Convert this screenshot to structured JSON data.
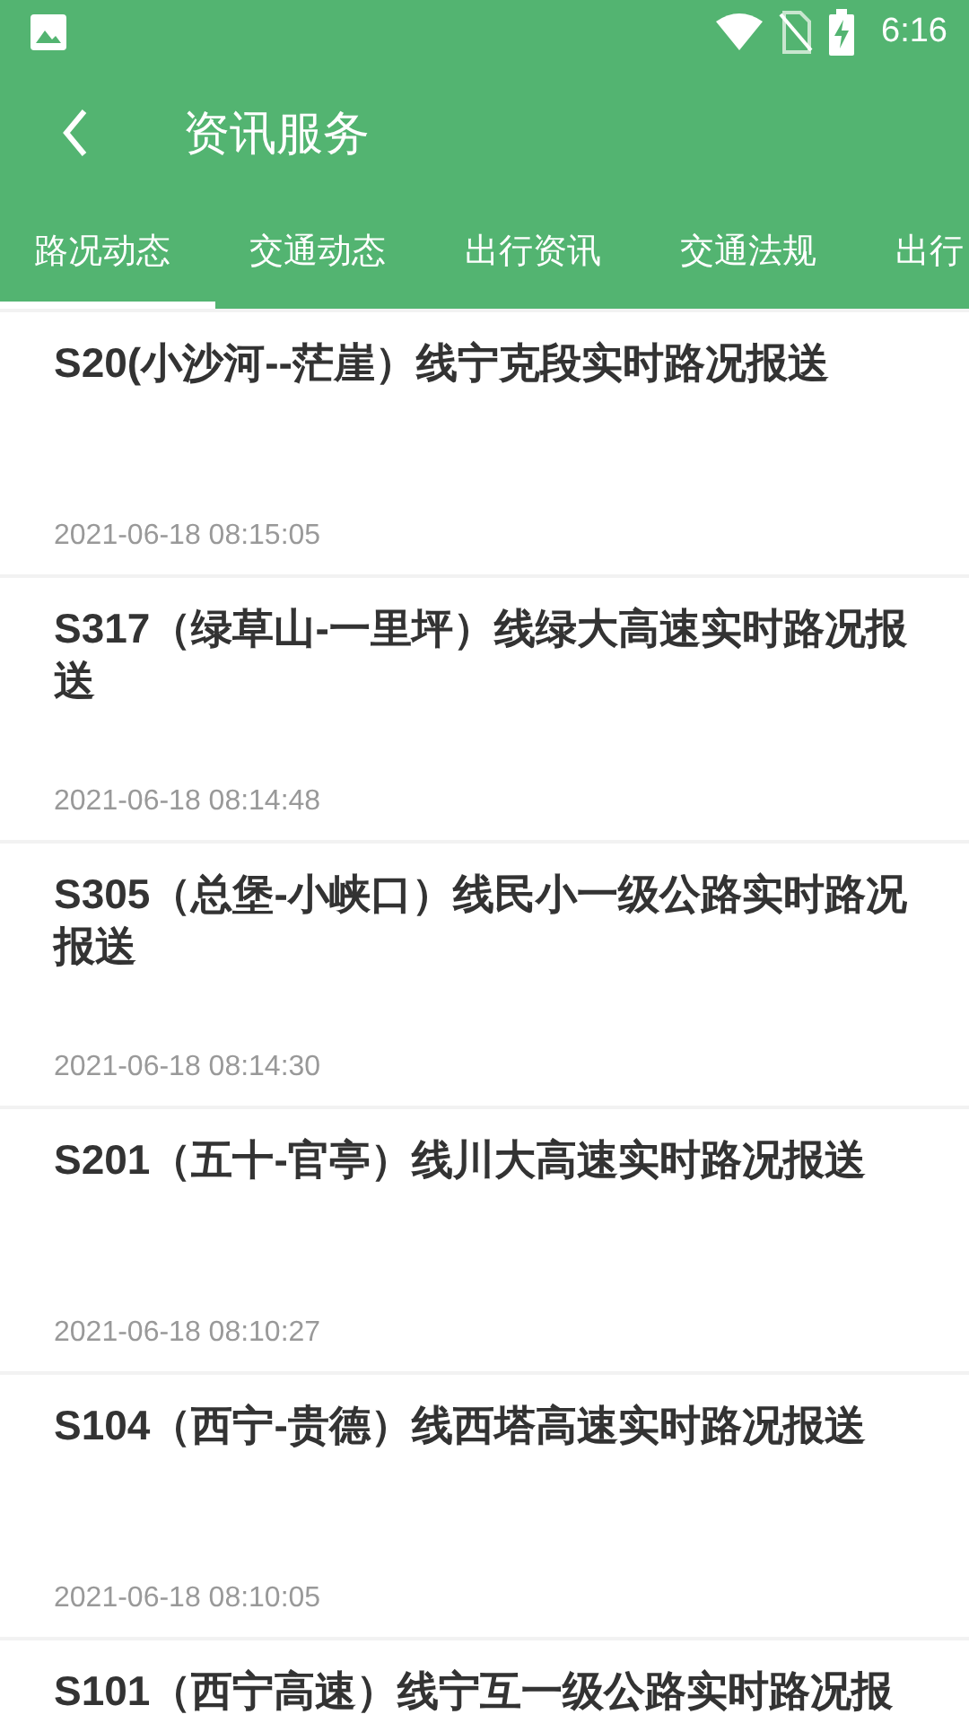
{
  "status_bar": {
    "time": "6:16"
  },
  "app_bar": {
    "title": "资讯服务"
  },
  "tabs": [
    {
      "label": "路况动态",
      "selected": true
    },
    {
      "label": "交通动态",
      "selected": false
    },
    {
      "label": "出行资讯",
      "selected": false
    },
    {
      "label": "交通法规",
      "selected": false
    },
    {
      "label": "出行",
      "selected": false
    }
  ],
  "news": [
    {
      "title": "S20(小沙河--茫崖）线宁克段实时路况报送",
      "date": "2021-06-18 08:15:05"
    },
    {
      "title": "S317（绿草山-一里坪）线绿大高速实时路况报送",
      "date": "2021-06-18 08:14:48"
    },
    {
      "title": "S305（总堡-小峡口）线民小一级公路实时路况报送",
      "date": "2021-06-18 08:14:30"
    },
    {
      "title": "S201（五十-官亭）线川大高速实时路况报送",
      "date": "2021-06-18 08:10:27"
    },
    {
      "title": "S104（西宁-贵德）线西塔高速实时路况报送",
      "date": "2021-06-18 08:10:05"
    },
    {
      "title": "S101（西宁高速）线宁互一级公路实时路况报"
    }
  ]
}
